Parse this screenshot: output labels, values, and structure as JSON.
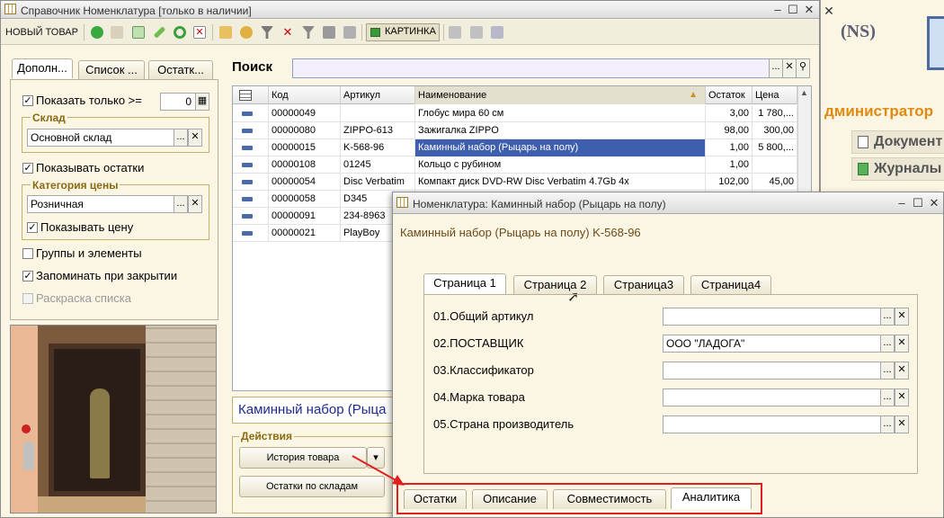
{
  "bg_window": {
    "logo_text": "(NS)",
    "admin_text": "дминистратор",
    "nav": [
      {
        "label": "Документ"
      },
      {
        "label": "Журналы"
      }
    ]
  },
  "main_window": {
    "title": "Справочник Номенклатура [только в наличии]",
    "toolbar": {
      "new_item": "НОВЫЙ ТОВАР",
      "picture": "КАРТИНКА"
    },
    "left_tabs": [
      "Дополн...",
      "Список ...",
      "Остатк..."
    ],
    "filters": {
      "show_only_label": "Показать только  >=",
      "show_only_value": "0",
      "warehouse_group": "Склад",
      "warehouse_value": "Основной склад",
      "show_stock": "Показывать остатки",
      "price_group": "Категория цены",
      "price_value": "Розничная",
      "show_price": "Показывать цену",
      "groups_elements": "Группы и элементы",
      "remember": "Запоминать при закрытии",
      "coloring": "Раскраска списка"
    },
    "search": {
      "label": "Поиск",
      "value": ""
    },
    "table": {
      "columns": [
        "Код",
        "Артикул",
        "Наименование",
        "Остаток",
        "Цена"
      ],
      "rows": [
        [
          "00000049",
          "",
          "Глобус мира 60 см",
          "3,00",
          "1 780,..."
        ],
        [
          "00000080",
          "ZIPPO-613",
          "Зажигалка ZIPPO",
          "98,00",
          "300,00"
        ],
        [
          "00000015",
          "K-568-96",
          "Каминный набор (Рыцарь на полу)",
          "1,00",
          "5 800,..."
        ],
        [
          "00000108",
          "01245",
          "Кольцо с рубином",
          "1,00",
          ""
        ],
        [
          "00000054",
          "Disc Verbatim",
          "Компакт диск DVD-RW Disc Verbatim 4.7Gb 4x",
          "102,00",
          "45,00"
        ],
        [
          "00000058",
          "D345",
          "",
          "",
          ""
        ],
        [
          "00000091",
          "234-8963",
          "",
          "",
          ""
        ],
        [
          "00000021",
          "PlayBoy",
          "",
          "",
          ""
        ]
      ]
    },
    "selected_name": "Каминный набор (Рыца",
    "actions": {
      "group": "Действия",
      "history": "История товара",
      "stock_by_wh": "Остатки по складам"
    }
  },
  "detail_window": {
    "title": "Номенклатура: Каминный набор (Рыцарь на полу)",
    "heading": "Каминный набор (Рыцарь на полу) K-568-96",
    "tabs": [
      "Страница 1",
      "Страница 2",
      "Страница3",
      "Страница4"
    ],
    "fields": [
      {
        "label": "01.Общий артикул",
        "value": ""
      },
      {
        "label": "02.ПОСТАВЩИК",
        "value": "ООО \"ЛАДОГА\""
      },
      {
        "label": "03.Классификатор",
        "value": ""
      },
      {
        "label": "04.Марка товара",
        "value": ""
      },
      {
        "label": "05.Страна производитель",
        "value": ""
      }
    ],
    "bottom_tabs": [
      "Остатки",
      "Описание",
      "Совместимость",
      "Аналитика"
    ]
  },
  "colors": {
    "selection": "#3e5eae",
    "annotation": "#e02020",
    "group_title": "#8a6a10"
  }
}
